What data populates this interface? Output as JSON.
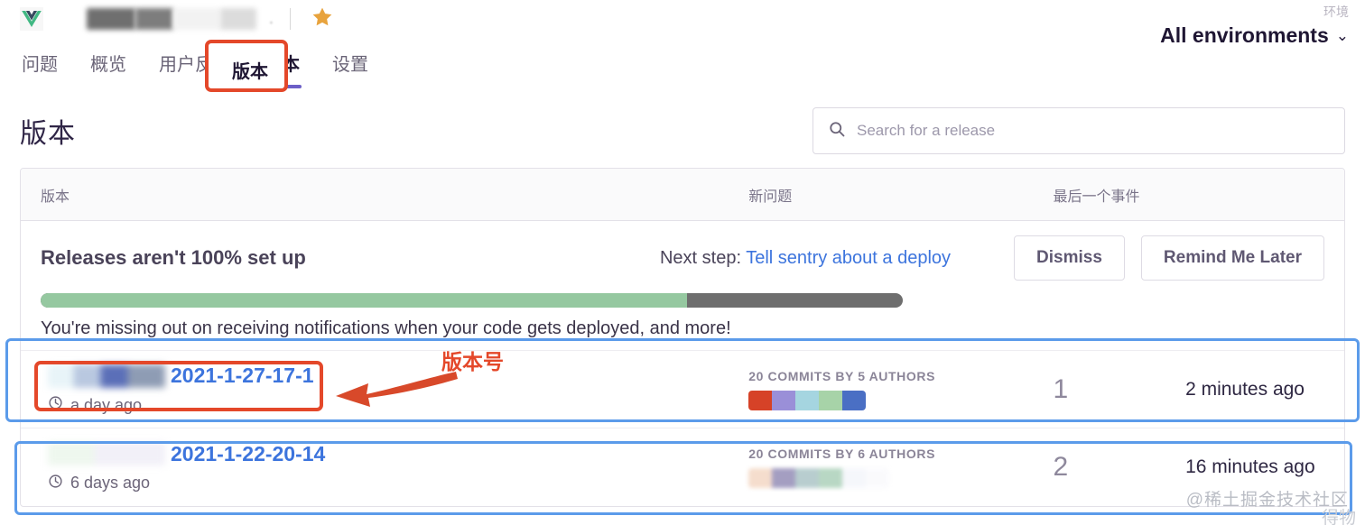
{
  "header": {
    "logo_icon": "vue-logo-icon",
    "breadcrumb_separator": ".",
    "star_icon": "star-icon",
    "tabs": [
      {
        "label": "问题",
        "active": false
      },
      {
        "label": "概览",
        "active": false
      },
      {
        "label": "用户反馈",
        "active": false
      },
      {
        "label": "版本",
        "active": true
      },
      {
        "label": "设置",
        "active": false
      }
    ],
    "environment": {
      "label": "环境",
      "value": "All environments",
      "chevron": "⌄"
    }
  },
  "page_title": "版本",
  "search": {
    "placeholder": "Search for a release",
    "value": "",
    "icon": "search-icon"
  },
  "table": {
    "columns": {
      "release": "版本",
      "new_issues": "新问题",
      "last_event": "最后一个事件"
    }
  },
  "setup_banner": {
    "title": "Releases aren't 100% set up",
    "next_step_prefix": "Next step: ",
    "next_step_link": "Tell sentry about a deploy",
    "dismiss_label": "Dismiss",
    "remind_label": "Remind Me Later",
    "progress_percent": 75,
    "progress_fill_color": "#95c8a0",
    "progress_track_color": "#6e6e6e",
    "subtitle": "You're missing out on receiving notifications when your code gets deployed, and more!"
  },
  "releases": [
    {
      "version": "2021-1-27-17-1",
      "version_prefix_redacted": true,
      "age": "a day ago",
      "commits": "20 COMMITS BY 5 AUTHORS",
      "author_colors": [
        "#d64227",
        "#9a8fd8",
        "#a5d5e0",
        "#a7d3a8",
        "#4a6fc4"
      ],
      "author_colors_faded": false,
      "new_issues": "1",
      "last_event": "2 minutes ago"
    },
    {
      "version": "2021-1-22-20-14",
      "version_prefix_redacted": true,
      "age": "6 days ago",
      "commits": "20 COMMITS BY 6 AUTHORS",
      "author_colors": [
        "#edc2a5",
        "#5b5090",
        "#7fa6a8",
        "#7fb894",
        "#eef1f8",
        "#f7f7fb"
      ],
      "author_colors_faded": true,
      "new_issues": "2",
      "last_event": "16 minutes ago"
    }
  ],
  "annotations": {
    "version_label": "版本号",
    "red_color": "#e4482a",
    "blue_color": "#5b9bea"
  },
  "watermark": {
    "primary": "@稀土掘金技术社区",
    "secondary": "得物"
  }
}
